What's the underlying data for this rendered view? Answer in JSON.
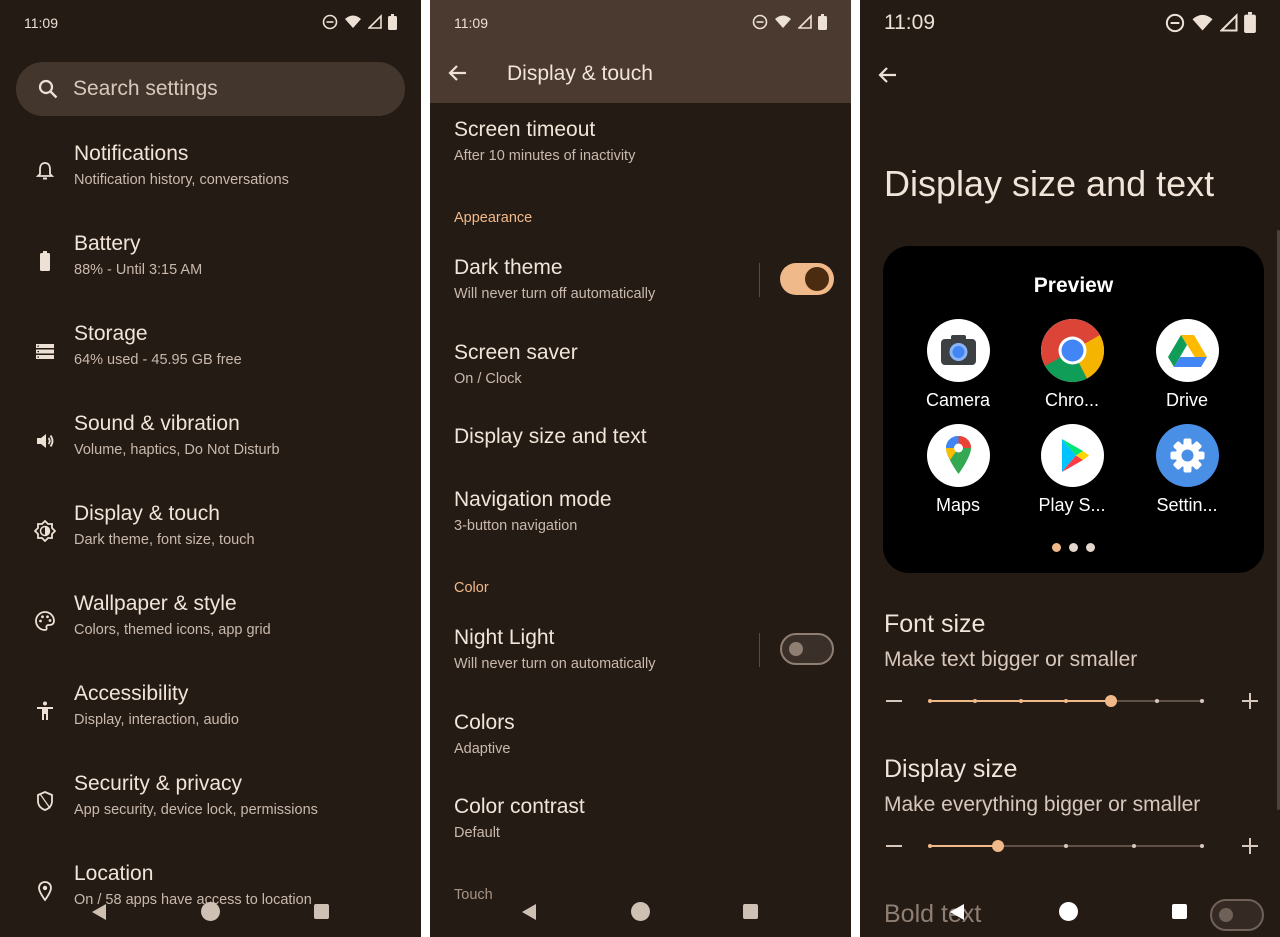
{
  "panel1": {
    "status_time": "11:09",
    "search_placeholder": "Search settings",
    "items": [
      {
        "title": "Notifications",
        "subtitle": "Notification history, conversations",
        "icon": "bell-icon"
      },
      {
        "title": "Battery",
        "subtitle": "88% - Until 3:15 AM",
        "icon": "battery-icon"
      },
      {
        "title": "Storage",
        "subtitle": "64% used - 45.95 GB free",
        "icon": "storage-icon"
      },
      {
        "title": "Sound & vibration",
        "subtitle": "Volume, haptics, Do Not Disturb",
        "icon": "speaker-icon"
      },
      {
        "title": "Display & touch",
        "subtitle": "Dark theme, font size, touch",
        "icon": "brightness-icon"
      },
      {
        "title": "Wallpaper & style",
        "subtitle": "Colors, themed icons, app grid",
        "icon": "palette-icon"
      },
      {
        "title": "Accessibility",
        "subtitle": "Display, interaction, audio",
        "icon": "accessibility-icon"
      },
      {
        "title": "Security & privacy",
        "subtitle": "App security, device lock, permissions",
        "icon": "shield-icon"
      },
      {
        "title": "Location",
        "subtitle": "On / 58 apps have access to location",
        "icon": "location-pin-icon"
      }
    ]
  },
  "panel2": {
    "status_time": "11:09",
    "title": "Display & touch",
    "screen_timeout": {
      "title": "Screen timeout",
      "subtitle": "After 10 minutes of inactivity"
    },
    "section_appearance": "Appearance",
    "dark_theme": {
      "title": "Dark theme",
      "subtitle": "Will never turn off automatically",
      "enabled": true
    },
    "screen_saver": {
      "title": "Screen saver",
      "subtitle": "On / Clock"
    },
    "display_size": {
      "title": "Display size and text"
    },
    "navigation_mode": {
      "title": "Navigation mode",
      "subtitle": "3-button navigation"
    },
    "section_color": "Color",
    "night_light": {
      "title": "Night Light",
      "subtitle": "Will never turn on automatically",
      "enabled": false
    },
    "colors": {
      "title": "Colors",
      "subtitle": "Adaptive"
    },
    "color_contrast": {
      "title": "Color contrast",
      "subtitle": "Default"
    },
    "section_touch": "Touch"
  },
  "panel3": {
    "status_time": "11:09",
    "title": "Display size and text",
    "preview_title": "Preview",
    "apps": [
      {
        "label": "Camera",
        "icon": "camera-app-icon"
      },
      {
        "label": "Chro...",
        "icon": "chrome-app-icon"
      },
      {
        "label": "Drive",
        "icon": "drive-app-icon"
      },
      {
        "label": "Maps",
        "icon": "maps-app-icon"
      },
      {
        "label": "Play S...",
        "icon": "play-store-app-icon"
      },
      {
        "label": "Settin...",
        "icon": "settings-app-icon"
      }
    ],
    "font_size": {
      "title": "Font size",
      "subtitle": "Make text bigger or smaller",
      "steps": 7,
      "value_index": 4
    },
    "display_size": {
      "title": "Display size",
      "subtitle": "Make everything bigger or smaller",
      "steps": 5,
      "value_index": 1
    },
    "bold_text": {
      "title": "Bold text",
      "enabled": false
    }
  },
  "colors": {
    "background": "#251b15",
    "app_bar": "#4a3a2f",
    "accent": "#f0b98a",
    "text_primary": "#f1e4d8",
    "text_secondary": "#c9b9ac"
  }
}
